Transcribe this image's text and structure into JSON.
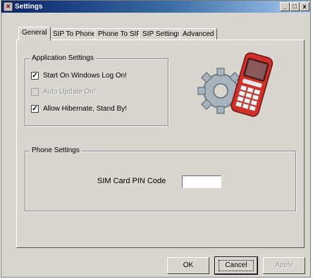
{
  "window": {
    "title": "Settings",
    "minimize_glyph": "_",
    "maximize_glyph": "□",
    "close_glyph": "x"
  },
  "tabs": [
    {
      "label": "General",
      "active": true
    },
    {
      "label": "SIP To Phone",
      "active": false
    },
    {
      "label": "Phone To SIP",
      "active": false
    },
    {
      "label": "SIP Settings",
      "active": false
    },
    {
      "label": "Advanced",
      "active": false
    }
  ],
  "application_settings": {
    "legend": "Application Settings",
    "options": [
      {
        "label": "Start On Windows Log On!",
        "checked": true,
        "enabled": true
      },
      {
        "label": "Auto Update On!",
        "checked": false,
        "enabled": false
      },
      {
        "label": "Allow Hibernate, Stand By!",
        "checked": true,
        "enabled": true
      }
    ]
  },
  "phone_settings": {
    "legend": "Phone Settings",
    "pin_label": "SIM Card PIN Code",
    "pin_value": ""
  },
  "buttons": {
    "ok": "OK",
    "cancel": "Cancel",
    "apply": "Apply"
  },
  "colors": {
    "title_start": "#0a246a",
    "title_end": "#a6caf0",
    "face": "#d8d6cf",
    "phone_body": "#d0302a"
  },
  "icons": {
    "illustration": "gear-and-mobile-phone-icon",
    "app": "settings-app-icon"
  }
}
